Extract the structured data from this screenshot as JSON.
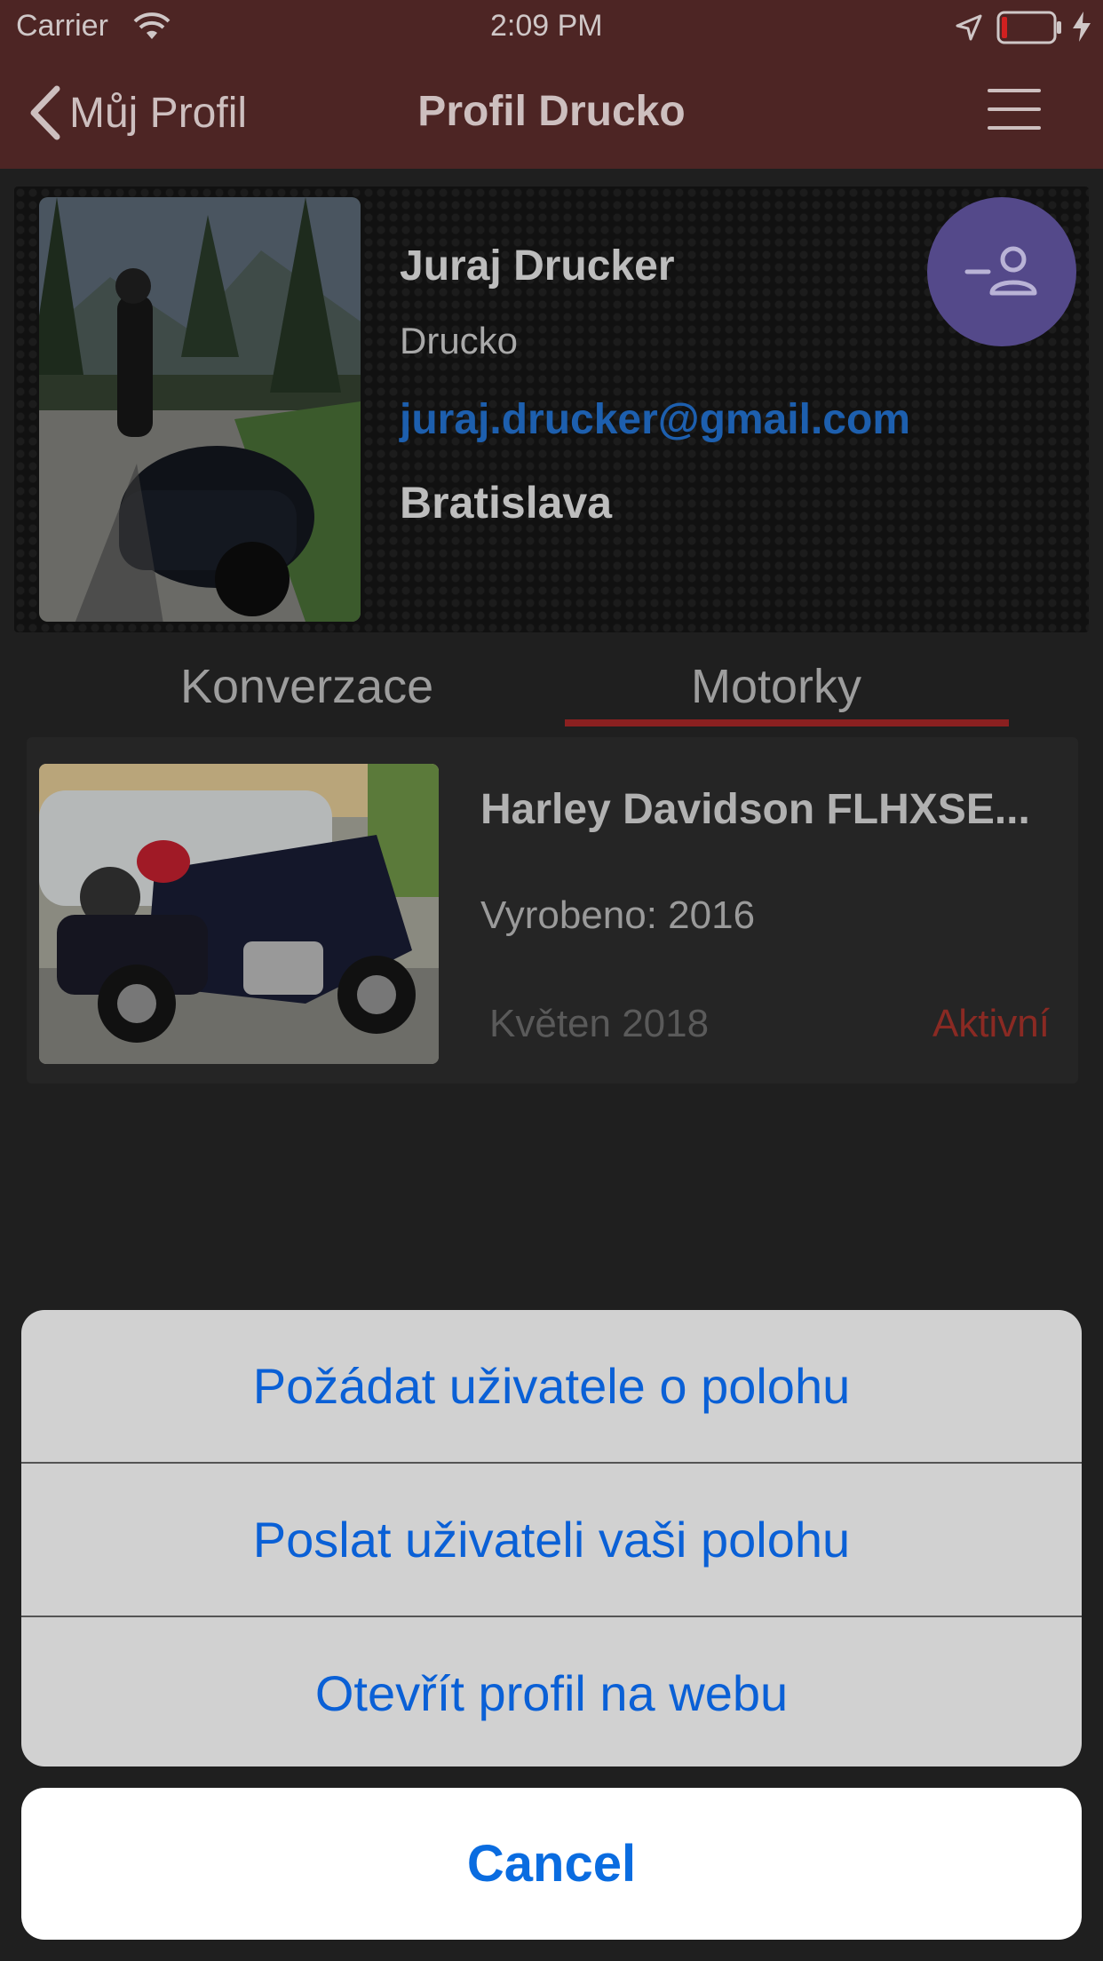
{
  "status_bar": {
    "carrier": "Carrier",
    "time": "2:09 PM"
  },
  "nav": {
    "back_label": "Můj Profil",
    "title": "Profil Drucko"
  },
  "profile": {
    "full_name": "Juraj Drucker",
    "nickname": "Drucko",
    "email": "juraj.drucker@gmail.com",
    "city": "Bratislava"
  },
  "tabs": [
    {
      "label": "Konverzace",
      "active": false
    },
    {
      "label": "Motorky",
      "active": true
    }
  ],
  "bike": {
    "title": "Harley Davidson FLHXSE...",
    "year": "Vyrobeno: 2016",
    "date": "Květen 2018",
    "status": "Aktivní"
  },
  "action_sheet": {
    "options": [
      "Požádat uživatele o polohu",
      "Poslat uživateli vaši polohu",
      "Otevřít profil na webu"
    ],
    "cancel": "Cancel"
  },
  "colors": {
    "nav_bg": "#4d2524",
    "accent_red": "#8b2020",
    "fab_purple": "#54498a",
    "ios_blue": "#0a60d6"
  }
}
